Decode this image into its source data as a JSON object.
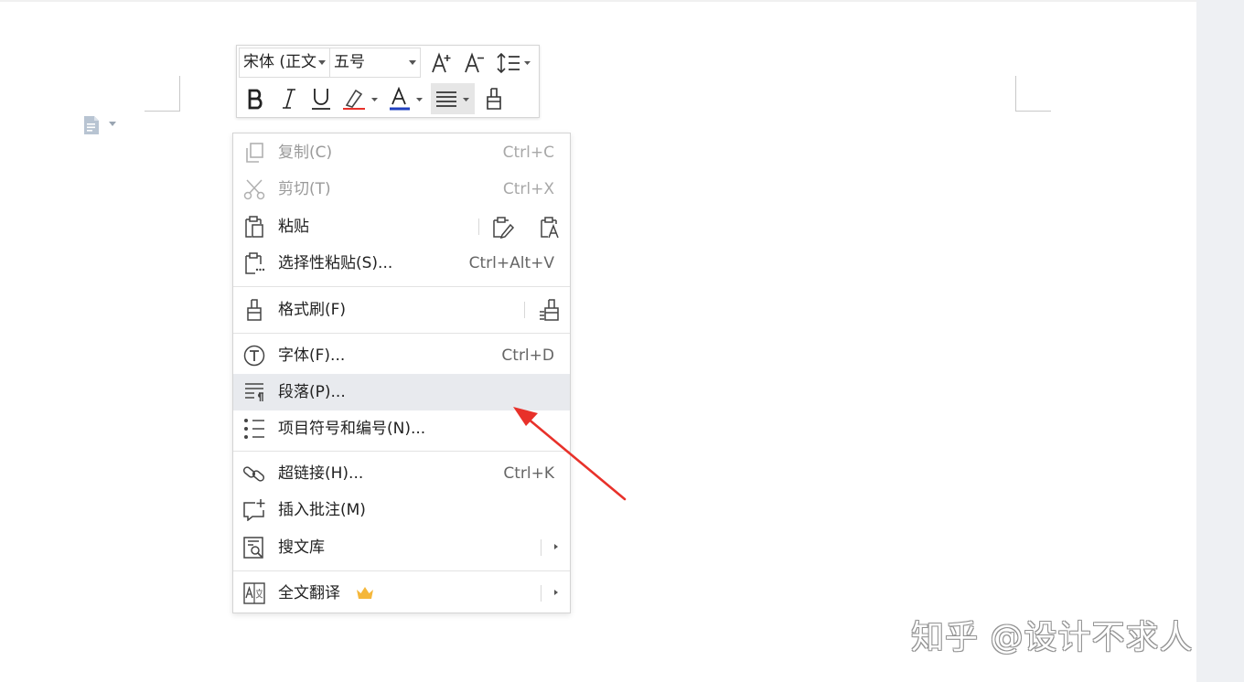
{
  "toolbar": {
    "font_name": "宋体 (正文",
    "font_size": "五号"
  },
  "menu": {
    "copy": {
      "label": "复制(C)",
      "shortcut": "Ctrl+C"
    },
    "cut": {
      "label": "剪切(T)",
      "shortcut": "Ctrl+X"
    },
    "paste": {
      "label": "粘贴"
    },
    "paste_special": {
      "label": "选择性粘贴(S)...",
      "shortcut": "Ctrl+Alt+V"
    },
    "format_painter": {
      "label": "格式刷(F)"
    },
    "font": {
      "label": "字体(F)...",
      "shortcut": "Ctrl+D"
    },
    "paragraph": {
      "label": "段落(P)..."
    },
    "bullets": {
      "label": "项目符号和编号(N)..."
    },
    "hyperlink": {
      "label": "超链接(H)...",
      "shortcut": "Ctrl+K"
    },
    "comment": {
      "label": "插入批注(M)"
    },
    "search_library": {
      "label": "搜文库"
    },
    "translate": {
      "label": "全文翻译"
    }
  },
  "watermark": "知乎 @设计不求人",
  "colors": {
    "highlight_row": "#e8eaee",
    "arrow": "#e8312a",
    "font_color_underline": "#1f3fbf",
    "crown": "#f5b73b"
  }
}
